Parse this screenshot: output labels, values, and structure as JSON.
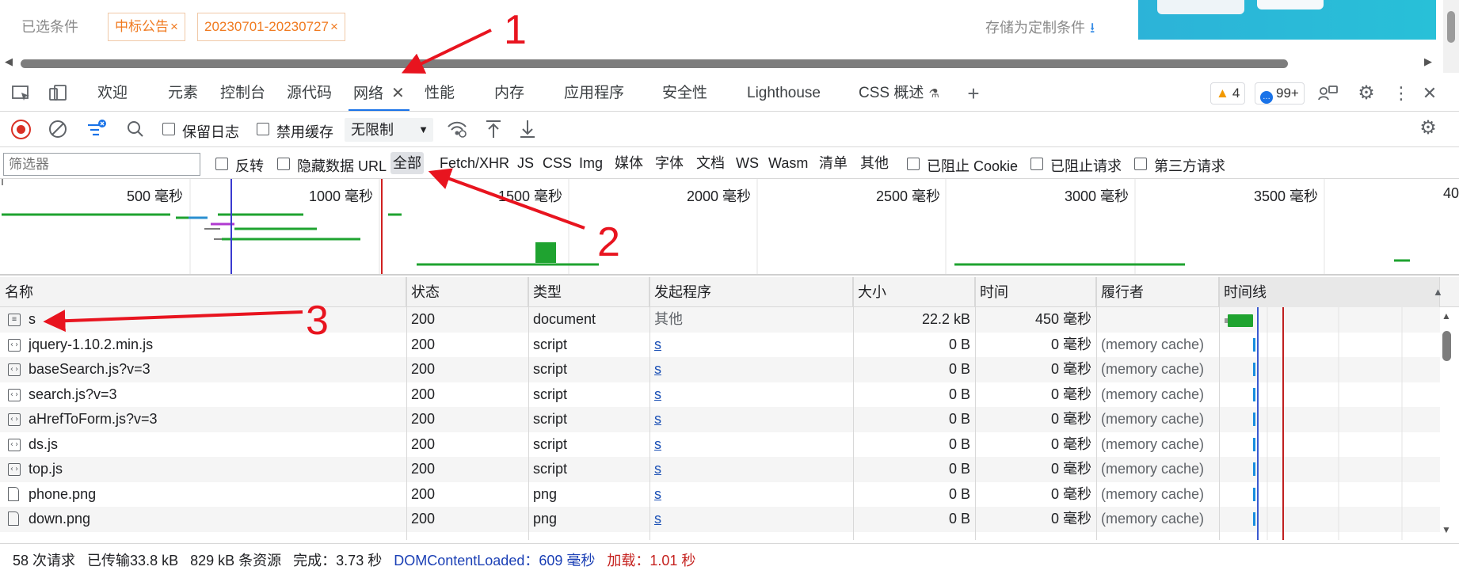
{
  "page": {
    "selected_label": "已选条件",
    "chips": [
      {
        "text": "中标公告",
        "close": "×"
      },
      {
        "text": "20230701-20230727",
        "close": "×"
      }
    ],
    "save_label": "存储为定制条件"
  },
  "devtools": {
    "tabs": [
      {
        "label": "欢迎"
      },
      {
        "label": "元素"
      },
      {
        "label": "控制台"
      },
      {
        "label": "源代码"
      },
      {
        "label": "网络",
        "active": true
      },
      {
        "label": "性能"
      },
      {
        "label": "内存"
      },
      {
        "label": "应用程序"
      },
      {
        "label": "安全性"
      },
      {
        "label": "Lighthouse"
      },
      {
        "label": "CSS 概述"
      }
    ],
    "warnings": "4",
    "messages": "99+"
  },
  "network_toolbar": {
    "preserve_log": "保留日志",
    "disable_cache": "禁用缓存",
    "throttle": "无限制"
  },
  "filter_bar": {
    "placeholder": "筛选器",
    "invert": "反转",
    "hide_data_urls": "隐藏数据 URL",
    "types": [
      "全部",
      "Fetch/XHR",
      "JS",
      "CSS",
      "Img",
      "媒体",
      "字体",
      "文档",
      "WS",
      "Wasm",
      "清单",
      "其他"
    ],
    "selected_type": "全部",
    "blocked_cookies": "已阻止 Cookie",
    "blocked_requests": "已阻止请求",
    "third_party": "第三方请求"
  },
  "overview": {
    "ticks": [
      "500  毫秒",
      "1000  毫秒",
      "1500  毫秒",
      "2000  毫秒",
      "2500  毫秒",
      "3000  毫秒",
      "3500  毫秒",
      "40"
    ]
  },
  "table": {
    "columns": [
      "名称",
      "状态",
      "类型",
      "发起程序",
      "大小",
      "时间",
      "履行者",
      "时间线"
    ],
    "rows": [
      {
        "name": "s",
        "icon": "document-icon",
        "status": "200",
        "type": "document",
        "initiator": "其他",
        "size": "22.2 kB",
        "time": "450  毫秒",
        "fulfilled": ""
      },
      {
        "name": "jquery-1.10.2.min.js",
        "icon": "script-icon",
        "status": "200",
        "type": "script",
        "initiator": "s",
        "size": "0 B",
        "time": "0  毫秒",
        "fulfilled": "(memory cache)"
      },
      {
        "name": "baseSearch.js?v=3",
        "icon": "script-icon",
        "status": "200",
        "type": "script",
        "initiator": "s",
        "size": "0 B",
        "time": "0  毫秒",
        "fulfilled": "(memory cache)"
      },
      {
        "name": "search.js?v=3",
        "icon": "script-icon",
        "status": "200",
        "type": "script",
        "initiator": "s",
        "size": "0 B",
        "time": "0  毫秒",
        "fulfilled": "(memory cache)"
      },
      {
        "name": "aHrefToForm.js?v=3",
        "icon": "script-icon",
        "status": "200",
        "type": "script",
        "initiator": "s",
        "size": "0 B",
        "time": "0  毫秒",
        "fulfilled": "(memory cache)"
      },
      {
        "name": "ds.js",
        "icon": "script-icon",
        "status": "200",
        "type": "script",
        "initiator": "s",
        "size": "0 B",
        "time": "0  毫秒",
        "fulfilled": "(memory cache)"
      },
      {
        "name": "top.js",
        "icon": "script-icon",
        "status": "200",
        "type": "script",
        "initiator": "s",
        "size": "0 B",
        "time": "0  毫秒",
        "fulfilled": "(memory cache)"
      },
      {
        "name": "phone.png",
        "icon": "image-file-icon",
        "status": "200",
        "type": "png",
        "initiator": "s",
        "size": "0 B",
        "time": "0  毫秒",
        "fulfilled": "(memory cache)"
      },
      {
        "name": "down.png",
        "icon": "image-file-icon",
        "status": "200",
        "type": "png",
        "initiator": "s",
        "size": "0 B",
        "time": "0  毫秒",
        "fulfilled": "(memory cache)"
      }
    ]
  },
  "status_bar": {
    "requests": "58 次请求",
    "transferred": "已传输33.8 kB",
    "resources": "829 kB 条资源",
    "finish": "完成：3.73 秒",
    "dcl": "DOMContentLoaded：609  毫秒",
    "load": "加载：1.01 秒"
  },
  "annotations": [
    "1",
    "2",
    "3"
  ],
  "colors": {
    "accent": "#1a73e8",
    "record": "#d93025",
    "annotation": "#e8141f",
    "chip": "#f07a20"
  }
}
